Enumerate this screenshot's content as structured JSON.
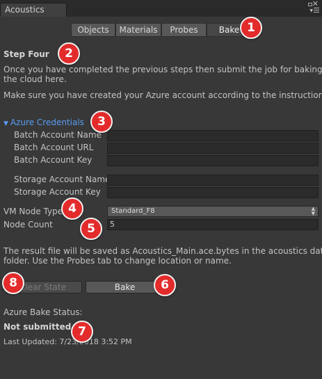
{
  "window": {
    "tab_title": "Acoustics",
    "lock_icon": "lock-icon",
    "close_glyph": "✕",
    "menu_icon": "menu-icon"
  },
  "tabs": [
    {
      "label": "Objects",
      "active": false
    },
    {
      "label": "Materials",
      "active": false
    },
    {
      "label": "Probes",
      "active": false
    },
    {
      "label": "Bake",
      "active": true
    }
  ],
  "step": {
    "title": "Step Four",
    "intro_line1": "Once you have completed the previous steps then submit the job for baking in",
    "intro_line2": "the cloud here.",
    "azure_note": "Make sure you have created your Azure account according to the instructions."
  },
  "credentials": {
    "foldout_label": "Azure Credentials",
    "foldout_arrow": "▼",
    "batch_name_label": "Batch Account Name",
    "batch_name_value": "",
    "batch_url_label": "Batch Account URL",
    "batch_url_value": "",
    "batch_key_label": "Batch Account Key",
    "batch_key_value": "",
    "storage_name_label": "Storage Account Name",
    "storage_name_value": "",
    "storage_key_label": "Storage Account Key",
    "storage_key_value": ""
  },
  "vm": {
    "node_type_label": "VM Node Type",
    "node_type_value": "Standard_F8",
    "dropdown_arrows": "▲▼",
    "node_count_label": "Node Count",
    "node_count_value": "5"
  },
  "result_note": {
    "line1": "The result file will be saved as Acoustics_Main.ace.bytes in the acoustics data",
    "line2": "folder. Use the Probes tab to change location or name."
  },
  "buttons": {
    "clear_state": "Clear State",
    "bake": "Bake"
  },
  "status": {
    "heading": "Azure Bake Status:",
    "value": "Not submitted",
    "last_updated": "Last Updated: 7/23/2018 3:52 PM"
  },
  "markers": [
    "1",
    "2",
    "3",
    "4",
    "5",
    "6",
    "7",
    "8"
  ],
  "colors": {
    "marker_red": "#e32b2b",
    "foldout_blue": "#5a9cf2",
    "panel_bg": "#383838"
  }
}
